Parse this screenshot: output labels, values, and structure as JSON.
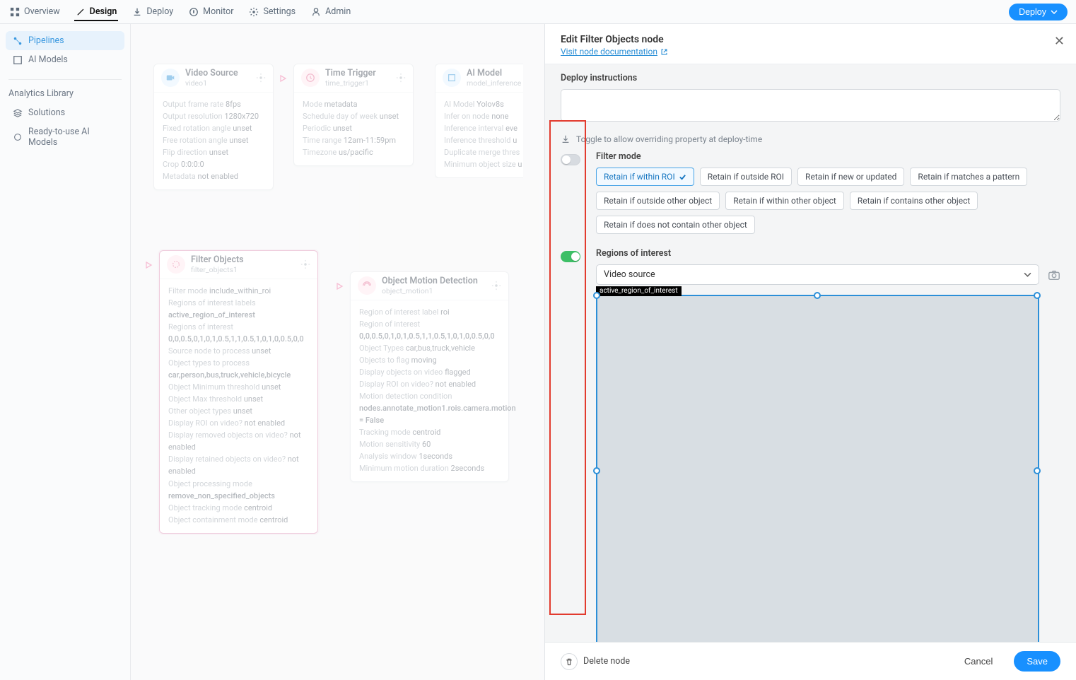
{
  "topnav": {
    "tabs": [
      {
        "label": "Overview"
      },
      {
        "label": "Design"
      },
      {
        "label": "Deploy"
      },
      {
        "label": "Monitor"
      },
      {
        "label": "Settings"
      },
      {
        "label": "Admin"
      }
    ],
    "active_tab": 1,
    "deploy_label": "Deploy"
  },
  "sidebar": {
    "items": [
      {
        "label": "Pipelines"
      },
      {
        "label": "AI Models"
      }
    ],
    "active_item": 0,
    "library_header": "Analytics Library",
    "library_items": [
      {
        "label": "Solutions"
      },
      {
        "label": "Ready-to-use AI Models"
      }
    ]
  },
  "canvas": {
    "video_source": {
      "title": "Video Source",
      "sub": "video1",
      "props": [
        {
          "k": "Output frame rate",
          "v": "8fps"
        },
        {
          "k": "Output resolution",
          "v": "1280x720"
        },
        {
          "k": "Fixed rotation angle",
          "v": "unset"
        },
        {
          "k": "Free rotation angle",
          "v": "unset"
        },
        {
          "k": "Flip direction",
          "v": "unset"
        },
        {
          "k": "Crop",
          "v": "0:0:0:0"
        },
        {
          "k": "Metadata",
          "v": "not enabled"
        }
      ]
    },
    "time_trigger": {
      "title": "Time Trigger",
      "sub": "time_trigger1",
      "props": [
        {
          "k": "Mode",
          "v": "metadata"
        },
        {
          "k": "Schedule day of week",
          "v": "unset"
        },
        {
          "k": "Periodic",
          "v": "unset"
        },
        {
          "k": "Time range",
          "v": "12am-11:59pm"
        },
        {
          "k": "Timezone",
          "v": "us/pacific"
        }
      ]
    },
    "ai_model": {
      "title": "AI Model",
      "sub": "model_inference",
      "props": [
        {
          "k": "AI Model",
          "v": "Yolov8s"
        },
        {
          "k": "Infer on node",
          "v": "none"
        },
        {
          "k": "Inference interval",
          "v": "eve"
        },
        {
          "k": "Inference threshold",
          "v": "u"
        },
        {
          "k": "Duplicate merge thres",
          "v": ""
        },
        {
          "k": "Minimum object size",
          "v": "u"
        }
      ]
    },
    "filter_objects": {
      "title": "Filter Objects",
      "sub": "filter_objects1",
      "props": [
        {
          "k": "Filter mode",
          "v": "include_within_roi"
        },
        {
          "k": "Regions of interest labels",
          "v": ""
        },
        {
          "kbold": "active_region_of_interest"
        },
        {
          "k": "Regions of interest",
          "v": ""
        },
        {
          "kbold": "0,0,0.5,0,1,0,1,0.5,1,1,0.5,1,0,1,0,0.5,0,0"
        },
        {
          "k": "Source node to process",
          "v": "unset"
        },
        {
          "k": "Object types to process",
          "v": ""
        },
        {
          "kbold": "car,person,bus,truck,vehicle,bicycle"
        },
        {
          "k": "Object Minimum threshold",
          "v": "unset"
        },
        {
          "k": "Object Max threshold",
          "v": "unset"
        },
        {
          "k": "Other object types",
          "v": "unset"
        },
        {
          "k": "Display ROI on video?",
          "v": "not enabled"
        },
        {
          "k": "Display removed objects on video?",
          "v": "not enabled"
        },
        {
          "k": "Display retained objects on video?",
          "v": "not enabled"
        },
        {
          "k": "Object processing mode",
          "v": ""
        },
        {
          "kbold": "remove_non_specified_objects"
        },
        {
          "k": "Object tracking mode",
          "v": "centroid"
        },
        {
          "k": "Object containment mode",
          "v": "centroid"
        }
      ]
    },
    "motion": {
      "title": "Object Motion Detection",
      "sub": "object_motion1",
      "props": [
        {
          "k": "Region of interest label",
          "v": "roi"
        },
        {
          "k": "Region of interest",
          "v": ""
        },
        {
          "kbold": "0,0,0.5,0,1,0,1,0.5,1,1,0.5,1,0,1,0,0.5,0,0"
        },
        {
          "k": "Object Types",
          "v": "car,bus,truck,vehicle"
        },
        {
          "k": "Objects to flag",
          "v": "moving"
        },
        {
          "k": "Display objects on video",
          "v": "flagged"
        },
        {
          "k": "Display ROI on video?",
          "v": "not enabled"
        },
        {
          "k": "Motion detection condition",
          "v": ""
        },
        {
          "kbold": "nodes.annotate_motion1.rois.camera.motion = False"
        },
        {
          "k": "Tracking mode",
          "v": "centroid"
        },
        {
          "k": "Motion sensitivity",
          "v": "60"
        },
        {
          "k": "Analysis window",
          "v": "1seconds"
        },
        {
          "k": "Minimum motion duration",
          "v": "2seconds"
        }
      ]
    }
  },
  "panel": {
    "title": "Edit Filter Objects node",
    "doc_link": "Visit node documentation",
    "deploy_instructions_label": "Deploy instructions",
    "toggle_hint": "Toggle to allow overriding property at deploy-time",
    "filter_mode_label": "Filter mode",
    "filter_modes": [
      "Retain if within ROI",
      "Retain if outside ROI",
      "Retain if new or updated",
      "Retain if matches a pattern",
      "Retain if outside other object",
      "Retain if within other object",
      "Retain if contains other object",
      "Retain if does not contain other object"
    ],
    "selected_mode": 0,
    "roi_label": "Regions of interest",
    "roi_select_value": "Video source",
    "roi_tag": "active_region_of_interest",
    "footer": {
      "delete": "Delete node",
      "cancel": "Cancel",
      "save": "Save"
    }
  }
}
